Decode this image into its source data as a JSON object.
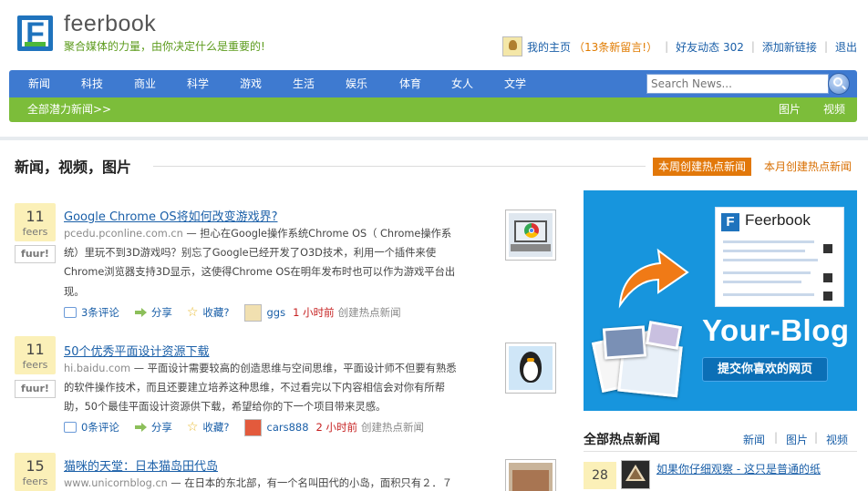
{
  "header": {
    "logo_letter": "F",
    "site_name": "feerbook",
    "tagline": "聚合媒体的力量，由你决定什么是重要的!",
    "user_links": {
      "my_home": "我的主页",
      "new_messages": "（13条新留言!）",
      "friends_activity": "好友动态 302",
      "add_link": "添加新链接",
      "logout": "退出"
    }
  },
  "nav": {
    "items": [
      "新闻",
      "科技",
      "商业",
      "科学",
      "游戏",
      "生活",
      "娱乐",
      "体育",
      "女人",
      "文学"
    ],
    "search_placeholder": "Search News...",
    "subnav": {
      "all": "全部潜力新闻>>",
      "pictures": "图片",
      "videos": "视频"
    }
  },
  "main": {
    "section_title": "新闻，视频，图片",
    "tab_week": "本周创建热点新闻",
    "tab_month": "本月创建热点新闻",
    "news": [
      {
        "count": "11",
        "count_unit": "feers",
        "fuur": "fuur!",
        "title": "Google Chrome OS将如何改变游戏界?",
        "source": "pcedu.pconline.com.cn",
        "body": " — 担心在Google操作系统Chrome OS（ Chrome操作系统）里玩不到3D游戏吗？别忘了Google已经开发了O3D技术，利用一个插件来使Chrome浏览器支持3D显示，这使得Chrome OS在明年发布时也可以作为游戏平台出现。",
        "comments": "3条评论",
        "share": "分享",
        "favorite": "收藏?",
        "user": "ggs",
        "time": "1 小时前",
        "action": "创建热点新闻"
      },
      {
        "count": "11",
        "count_unit": "feers",
        "fuur": "fuur!",
        "title": "50个优秀平面设计资源下载",
        "source": "hi.baidu.com",
        "body": " — 平面设计需要较高的创造思维与空间思维，平面设计师不但要有熟悉的软件操作技术，而且还要建立培养这种思维，不过看完以下内容相信会对你有所帮助，50个最佳平面设计资源供下载，希望给你的下一个项目带来灵感。",
        "comments": "0条评论",
        "share": "分享",
        "favorite": "收藏?",
        "user": "cars888",
        "time": "2 小时前",
        "action": "创建热点新闻"
      },
      {
        "count": "15",
        "count_unit": "feers",
        "title": "猫咪的天堂：日本猫岛田代岛",
        "source": "www.unicornblog.cn",
        "body": " — 在日本的东北部，有一个名叫田代的小岛，面积只有２．７"
      }
    ]
  },
  "sidebar": {
    "ad": {
      "card_title": "Feerbook",
      "headline": "Your-Blog",
      "cta": "提交你喜欢的网页"
    },
    "hot": {
      "title": "全部热点新闻",
      "links": [
        "新闻",
        "图片",
        "视频"
      ],
      "items": [
        {
          "count": "28",
          "title": "如果你仔细观察 - 这只是普通的纸"
        }
      ]
    }
  }
}
